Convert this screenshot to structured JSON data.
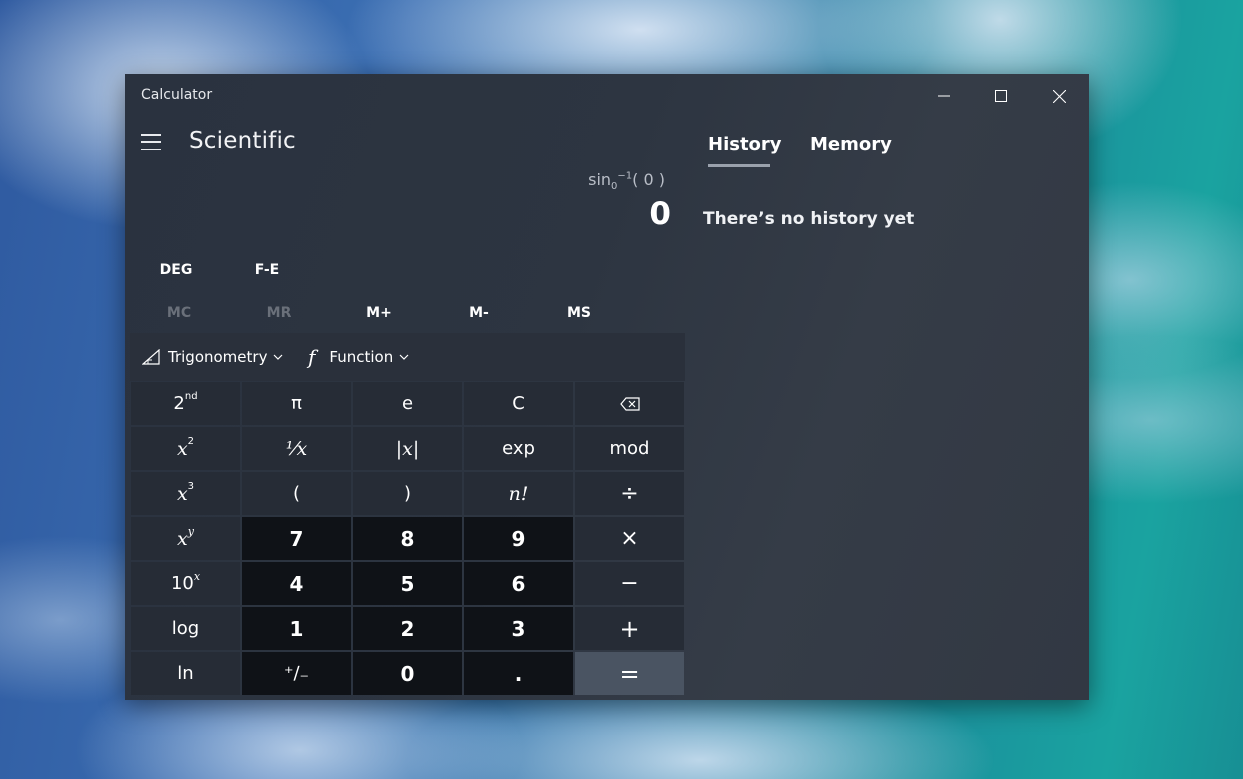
{
  "window": {
    "title": "Calculator",
    "controls": {
      "minimize": "minimize-icon",
      "maximize": "maximize-icon",
      "close": "close-icon"
    }
  },
  "header": {
    "mode": "Scientific",
    "menu_icon": "hamburger-menu-icon"
  },
  "display": {
    "expression_fn": "sin",
    "expression_sub": "0",
    "expression_sup": "−1",
    "expression_arg": "( 0 )",
    "result": "0"
  },
  "toggles": {
    "angle": "DEG",
    "fe": "F-E"
  },
  "memory": {
    "mc": "MC",
    "mr": "MR",
    "mplus": "M+",
    "mminus": "M-",
    "ms": "MS"
  },
  "functions": {
    "trig": "Trigonometry",
    "func": "Function",
    "func_symbol": "f"
  },
  "keys": {
    "second": "2",
    "second_sup": "nd",
    "pi": "π",
    "e": "e",
    "clear": "C",
    "x2_base": "x",
    "x2_sup": "2",
    "reciprocal": "¹⁄x",
    "abs": "|x|",
    "exp": "exp",
    "mod": "mod",
    "x3_base": "x",
    "x3_sup": "3",
    "lparen": "(",
    "rparen": ")",
    "factorial": "n!",
    "divide": "÷",
    "xy_base": "x",
    "xy_sup": "y",
    "seven": "7",
    "eight": "8",
    "nine": "9",
    "multiply": "×",
    "ten_base": "10",
    "ten_sup": "x",
    "four": "4",
    "five": "5",
    "six": "6",
    "minus": "−",
    "log": "log",
    "one": "1",
    "two": "2",
    "three": "3",
    "plus": "+",
    "ln": "ln",
    "negate": "⁺∕₋",
    "zero": "0",
    "decimal": ".",
    "equals": "="
  },
  "history": {
    "tab_history": "History",
    "tab_memory": "Memory",
    "empty_text": "There’s no history yet"
  },
  "colors": {
    "window_bg": "#2d3541",
    "number_key_bg": "#0f1217",
    "function_key_bg": "#262c36",
    "equals_bg": "#4a5462",
    "disabled_text": "#6a707a"
  }
}
